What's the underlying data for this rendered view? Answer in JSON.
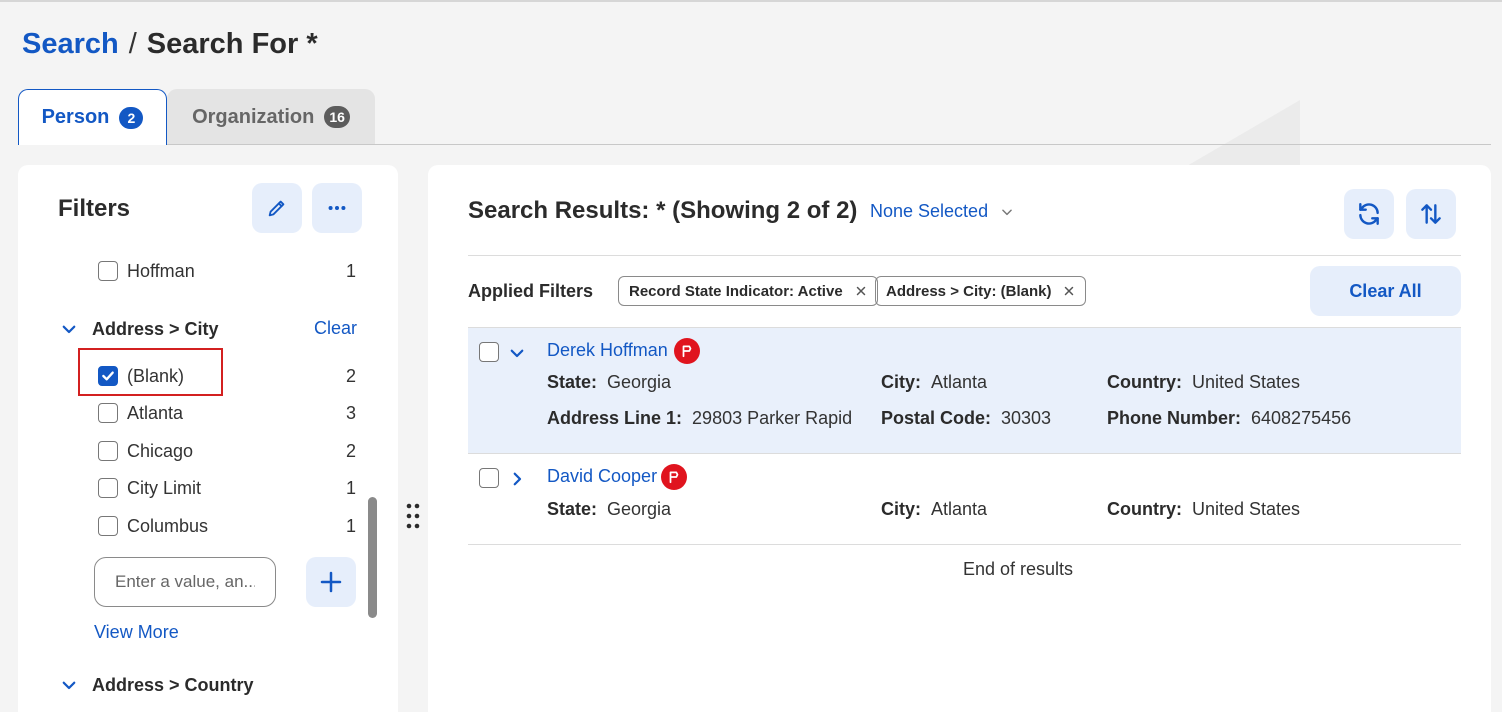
{
  "breadcrumb": {
    "root": "Search",
    "separator": "/",
    "current": "Search For *"
  },
  "tabs": [
    {
      "label": "Person",
      "count": "2"
    },
    {
      "label": "Organization",
      "count": "16"
    }
  ],
  "filters": {
    "title": "Filters",
    "top_items": [
      {
        "label": "Hoffman",
        "count": "1"
      }
    ],
    "city_section": {
      "title": "Address > City",
      "clear_label": "Clear",
      "items": [
        {
          "label": "(Blank)",
          "count": "2",
          "checked": true
        },
        {
          "label": "Atlanta",
          "count": "3",
          "checked": false
        },
        {
          "label": "Chicago",
          "count": "2",
          "checked": false
        },
        {
          "label": "City Limit",
          "count": "1",
          "checked": false
        },
        {
          "label": "Columbus",
          "count": "1",
          "checked": false
        }
      ],
      "input_placeholder": "Enter a value, an...",
      "view_more": "View More"
    },
    "country_section": {
      "title": "Address > Country"
    }
  },
  "results": {
    "title": "Search Results: * (Showing 2 of 2)",
    "selection": "None Selected",
    "applied_label": "Applied Filters",
    "chips": [
      "Record State Indicator: Active",
      "Address > City: (Blank)"
    ],
    "clear_all": "Clear All",
    "records": [
      {
        "name": "Derek Hoffman",
        "fields": [
          {
            "label": "State:",
            "value": "Georgia"
          },
          {
            "label": "City:",
            "value": "Atlanta"
          },
          {
            "label": "Country:",
            "value": "United States"
          },
          {
            "label": "Address Line 1:",
            "value": "29803 Parker Rapid"
          },
          {
            "label": "Postal Code:",
            "value": "30303"
          },
          {
            "label": "Phone Number:",
            "value": "6408275456"
          }
        ]
      },
      {
        "name": "David Cooper",
        "fields": [
          {
            "label": "State:",
            "value": "Georgia"
          },
          {
            "label": "City:",
            "value": "Atlanta"
          },
          {
            "label": "Country:",
            "value": "United States"
          }
        ]
      }
    ],
    "end_text": "End of results"
  },
  "colors": {
    "accent": "#1358c4",
    "flag": "#e0141e",
    "highlight": "#d32020",
    "selected_row": "#e9f0fb"
  },
  "icons": [
    "pencil-icon",
    "more-icon",
    "chevron-down-icon",
    "chevron-right-icon",
    "check-icon",
    "plus-icon",
    "refresh-icon",
    "sort-icon",
    "close-icon",
    "flag-icon",
    "drag-handle-icon"
  ]
}
